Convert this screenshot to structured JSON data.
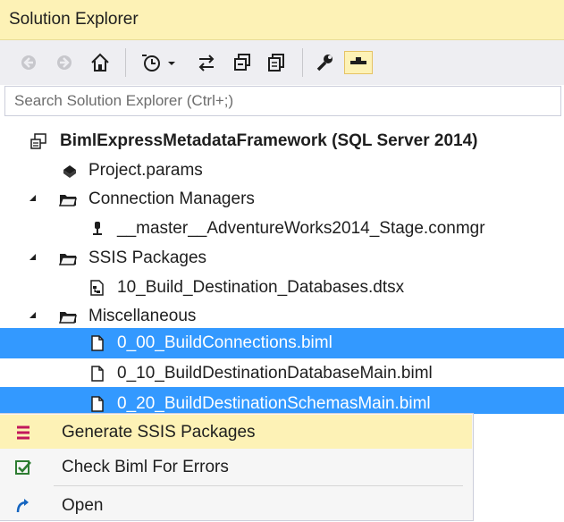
{
  "panel": {
    "title": "Solution Explorer"
  },
  "search": {
    "placeholder": "Search Solution Explorer (Ctrl+;)"
  },
  "toolbar": {
    "buttons": [
      "back-icon",
      "forward-icon",
      "home-icon",
      "pending-changes-filter-icon",
      "sync-icon",
      "collapse-all-icon",
      "show-all-files-icon",
      "properties-icon",
      "preview-selected-items-icon"
    ],
    "active_button": "preview-selected-items-icon"
  },
  "tree": {
    "solution": "BimlExpressMetadataFramework (SQL Server 2014)",
    "project_params": "Project.params",
    "connection_managers": {
      "label": "Connection Managers",
      "items": [
        "__master__AdventureWorks2014_Stage.conmgr"
      ]
    },
    "ssis_packages": {
      "label": "SSIS Packages",
      "items": [
        "10_Build_Destination_Databases.dtsx"
      ]
    },
    "miscellaneous": {
      "label": "Miscellaneous",
      "items": [
        {
          "label": "0_00_BuildConnections.biml",
          "selected": true
        },
        {
          "label": "0_10_BuildDestinationDatabaseMain.biml",
          "selected": false
        },
        {
          "label": "0_20_BuildDestinationSchemasMain.biml",
          "selected": true
        }
      ]
    }
  },
  "context_menu": {
    "items": [
      {
        "label": "Generate SSIS Packages",
        "icon": "generate-packages-icon",
        "highlighted": true
      },
      {
        "label": "Check Biml For Errors",
        "icon": "check-errors-icon",
        "highlighted": false
      },
      {
        "label": "Open",
        "icon": "open-icon",
        "highlighted": false
      }
    ]
  },
  "colors": {
    "title_bg": "#fdf2b6",
    "selection": "#3399ff",
    "toolbar_bg": "#eeeef2"
  }
}
